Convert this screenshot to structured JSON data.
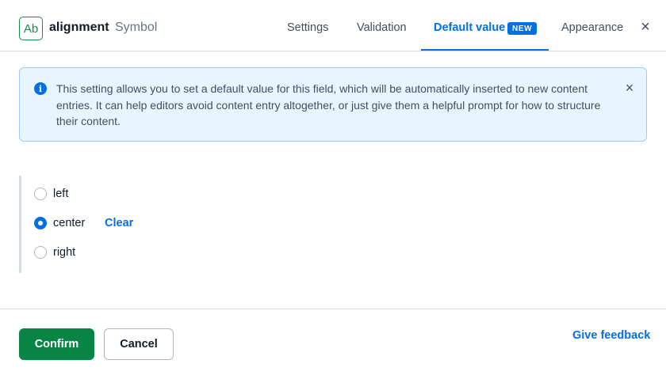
{
  "header": {
    "field_icon_text": "Ab",
    "field_name": "alignment",
    "field_type": "Symbol",
    "tabs": [
      {
        "label": "Settings",
        "active": false
      },
      {
        "label": "Validation",
        "active": false
      },
      {
        "label": "Default value",
        "active": true,
        "badge": "NEW"
      },
      {
        "label": "Appearance",
        "active": false
      }
    ],
    "close_icon": "×"
  },
  "note": {
    "icon": "i",
    "text": "This setting allows you to set a default value for this field, which will be automatically inserted to new content entries. It can help editors avoid content entry altogether, or just give them a helpful prompt for how to structure their content.",
    "close_icon": "×"
  },
  "options": [
    {
      "label": "left",
      "checked": false
    },
    {
      "label": "center",
      "checked": true
    },
    {
      "label": "right",
      "checked": false
    }
  ],
  "clear_label": "Clear",
  "footer": {
    "confirm_label": "Confirm",
    "cancel_label": "Cancel",
    "feedback_label": "Give feedback"
  },
  "colors": {
    "accent": "#036fe3",
    "confirm": "#088544",
    "field_icon": "#1a8a4f",
    "note_bg": "#e8f5ff"
  }
}
